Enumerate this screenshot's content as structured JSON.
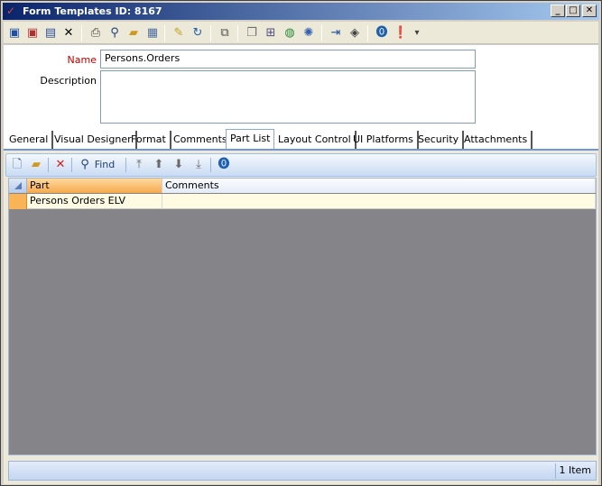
{
  "window": {
    "title": "Form Templates ID: 8167",
    "minimize": "_",
    "maximize": "□",
    "close": "✕"
  },
  "toolbar": {
    "icons": [
      "save-icon",
      "save-close-icon",
      "save-all-icon",
      "delete-icon",
      "print-icon",
      "find-icon",
      "open-folder-icon",
      "properties-icon",
      "edit-icon",
      "refresh-icon",
      "link-icon",
      "copy-icon",
      "export-icon",
      "globe-icon",
      "cycle-icon",
      "import-icon",
      "tag-icon",
      "help-icon",
      "info-icon",
      "overflow-icon"
    ]
  },
  "form": {
    "name_label": "Name",
    "name_value": "Persons.Orders",
    "description_label": "Description",
    "description_value": ""
  },
  "tabs": [
    {
      "label": "General"
    },
    {
      "label": "Visual Designer"
    },
    {
      "label": "Format"
    },
    {
      "label": "Comments"
    },
    {
      "label": "Part List"
    },
    {
      "label": "Layout Control"
    },
    {
      "label": "UI Platforms"
    },
    {
      "label": "Security"
    },
    {
      "label": "Attachments"
    }
  ],
  "active_tab": "Part List",
  "part_toolbar": {
    "find_label": "Find"
  },
  "grid": {
    "columns": [
      "Part",
      "Comments"
    ],
    "rows": [
      {
        "part": "Persons Orders ELV",
        "comments": ""
      }
    ]
  },
  "status": {
    "count": "1 Item"
  }
}
